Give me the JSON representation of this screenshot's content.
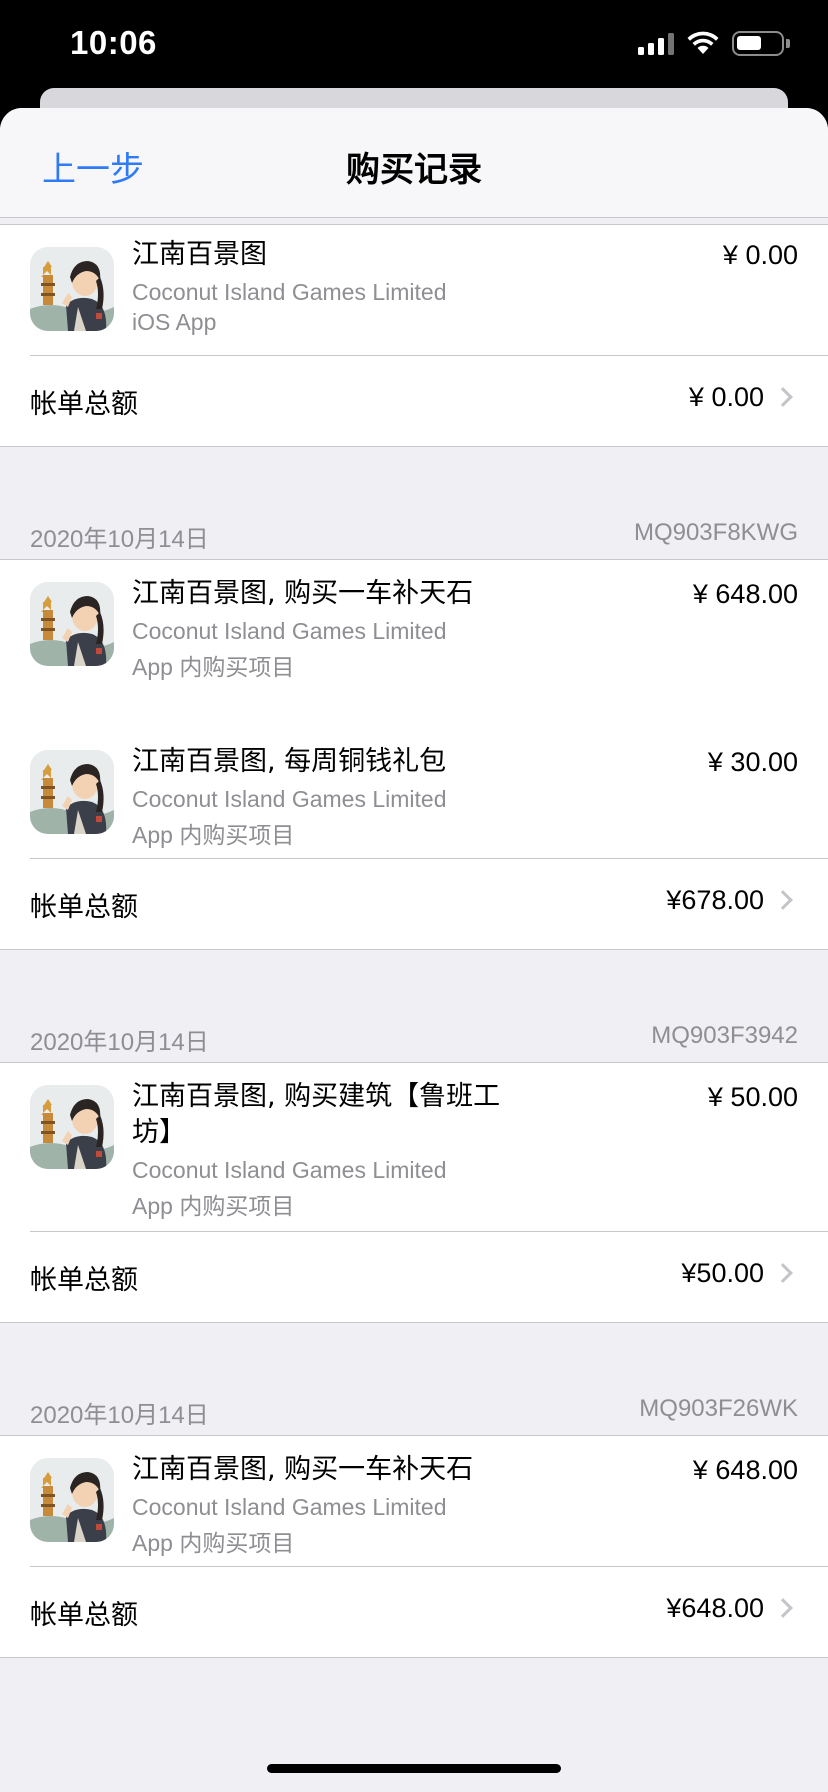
{
  "status_bar": {
    "time": "10:06"
  },
  "nav": {
    "back_label": "上一步",
    "title": "购买记录"
  },
  "top_group": {
    "item": {
      "title": "江南百景图",
      "developer": "Coconut Island Games Limited",
      "type": "iOS App",
      "price": "¥ 0.00"
    },
    "total_label": "帐单总额",
    "total_amount": "¥ 0.00"
  },
  "orders": [
    {
      "date": "2020年10月14日",
      "order_id": "MQ903F8KWG",
      "items": [
        {
          "title": "江南百景图, 购买一车补天石",
          "developer": "Coconut Island Games Limited",
          "type": "App 内购买项目",
          "price": "¥ 648.00"
        },
        {
          "title": "江南百景图, 每周铜钱礼包",
          "developer": "Coconut Island Games Limited",
          "type": "App 内购买项目",
          "price": "¥ 30.00"
        }
      ],
      "total_label": "帐单总额",
      "total_amount": "¥678.00"
    },
    {
      "date": "2020年10月14日",
      "order_id": "MQ903F3942",
      "items": [
        {
          "title": "江南百景图, 购买建筑【鲁班工坊】",
          "developer": "Coconut Island Games Limited",
          "type": "App 内购买项目",
          "price": "¥ 50.00"
        }
      ],
      "total_label": "帐单总额",
      "total_amount": "¥50.00"
    },
    {
      "date": "2020年10月14日",
      "order_id": "MQ903F26WK",
      "items": [
        {
          "title": "江南百景图, 购买一车补天石",
          "developer": "Coconut Island Games Limited",
          "type": "App 内购买项目",
          "price": "¥ 648.00"
        }
      ],
      "total_label": "帐单总额",
      "total_amount": "¥648.00"
    }
  ],
  "colors": {
    "accent": "#2f7bf5",
    "secondary_text": "#8e8e93",
    "separator": "#c8c7cc",
    "grouped_background": "#efeff4"
  },
  "icons": {
    "app_icon": "app-icon",
    "chevron": "chevron-right-icon",
    "wifi": "wifi-icon",
    "signal": "signal-icon",
    "battery": "battery-icon"
  }
}
